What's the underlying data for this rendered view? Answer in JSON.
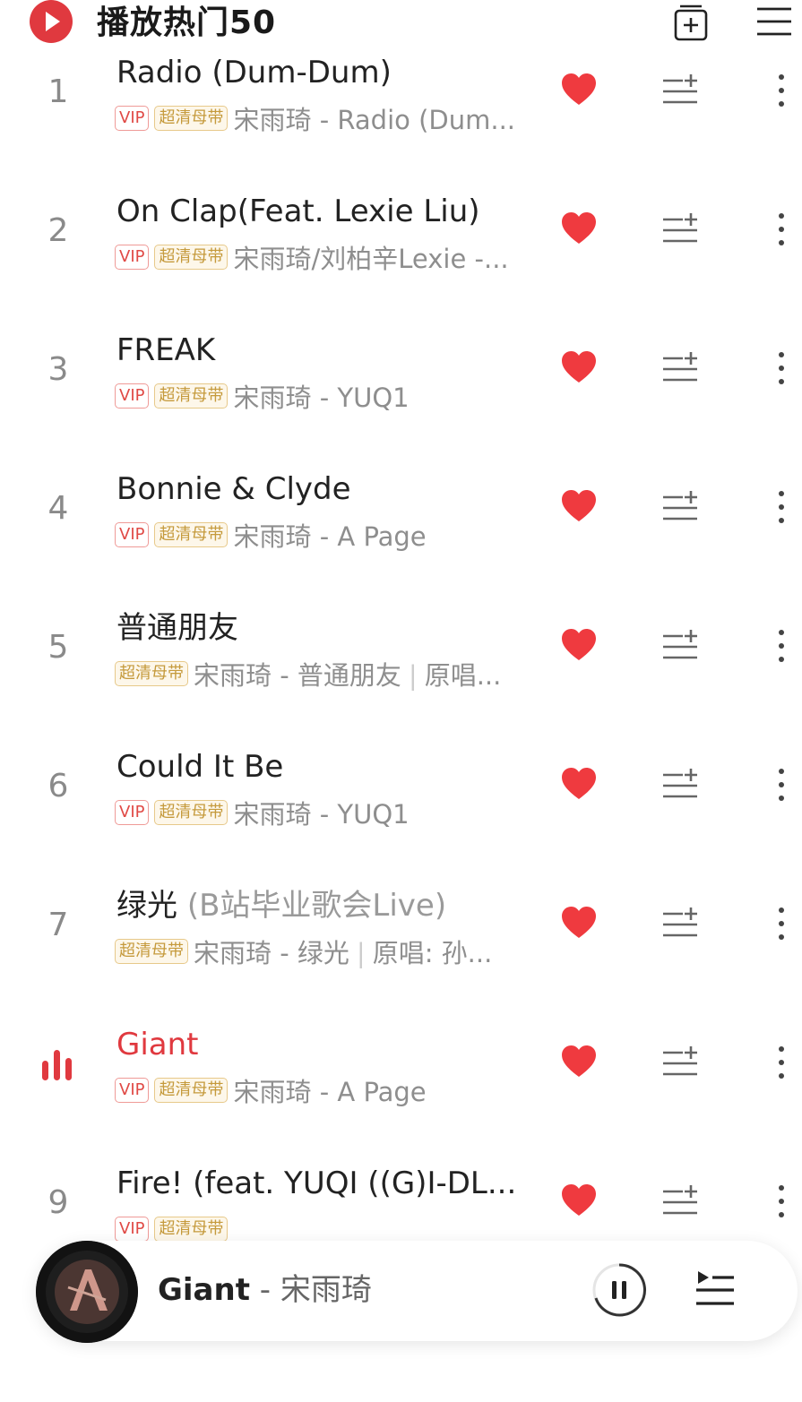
{
  "header": {
    "title": "播放热门50"
  },
  "colors": {
    "accent_red": "#e0393f",
    "vip_tag": "#e04a46",
    "hq_tag": "#c59a3c",
    "muted_text": "#8e8e8e"
  },
  "songs": [
    {
      "rank": "1",
      "title": "Radio (Dum-Dum)",
      "title_sub": "",
      "vip": "VIP",
      "quality": "超清母带",
      "meta": "宋雨琦 - Radio (Dum...",
      "meta_extra": ""
    },
    {
      "rank": "2",
      "title": "On Clap(Feat. Lexie Liu)",
      "title_sub": "",
      "vip": "VIP",
      "quality": "超清母带",
      "meta": "宋雨琦/刘柏辛Lexie -...",
      "meta_extra": ""
    },
    {
      "rank": "3",
      "title": "FREAK",
      "title_sub": "",
      "vip": "VIP",
      "quality": "超清母带",
      "meta": "宋雨琦 - YUQ1",
      "meta_extra": ""
    },
    {
      "rank": "4",
      "title": "Bonnie & Clyde",
      "title_sub": "",
      "vip": "VIP",
      "quality": "超清母带",
      "meta": "宋雨琦 - A Page",
      "meta_extra": ""
    },
    {
      "rank": "5",
      "title": "普通朋友",
      "title_sub": "",
      "vip": "",
      "quality": "超清母带",
      "meta": "宋雨琦 - 普通朋友",
      "meta_extra": "原唱..."
    },
    {
      "rank": "6",
      "title": "Could It Be",
      "title_sub": "",
      "vip": "VIP",
      "quality": "超清母带",
      "meta": "宋雨琦 - YUQ1",
      "meta_extra": ""
    },
    {
      "rank": "7",
      "title": "绿光",
      "title_sub": "(B站毕业歌会Live)",
      "vip": "",
      "quality": "超清母带",
      "meta": "宋雨琦 - 绿光",
      "meta_extra": "原唱: 孙..."
    },
    {
      "rank": "8",
      "title": "Giant",
      "title_sub": "",
      "vip": "VIP",
      "quality": "超清母带",
      "meta": "宋雨琦 - A Page",
      "meta_extra": "",
      "playing": true
    },
    {
      "rank": "9",
      "title": "Fire! (feat. YUQI ((G)I-DL...",
      "title_sub": "",
      "vip": "VIP",
      "quality": "超清母带",
      "meta": "",
      "meta_extra": ""
    }
  ],
  "now_playing": {
    "title": "Giant",
    "artist": " - 宋雨琦"
  },
  "icons": {
    "logo": "netease-play-logo",
    "add_playlist": "add-to-playlist-icon",
    "menu": "hamburger-menu-icon",
    "heart": "heart-icon",
    "add_queue": "add-to-queue-icon",
    "more": "more-vertical-icon",
    "playing": "equalizer-bars-icon",
    "pause": "pause-icon",
    "playlist": "playlist-icon"
  }
}
